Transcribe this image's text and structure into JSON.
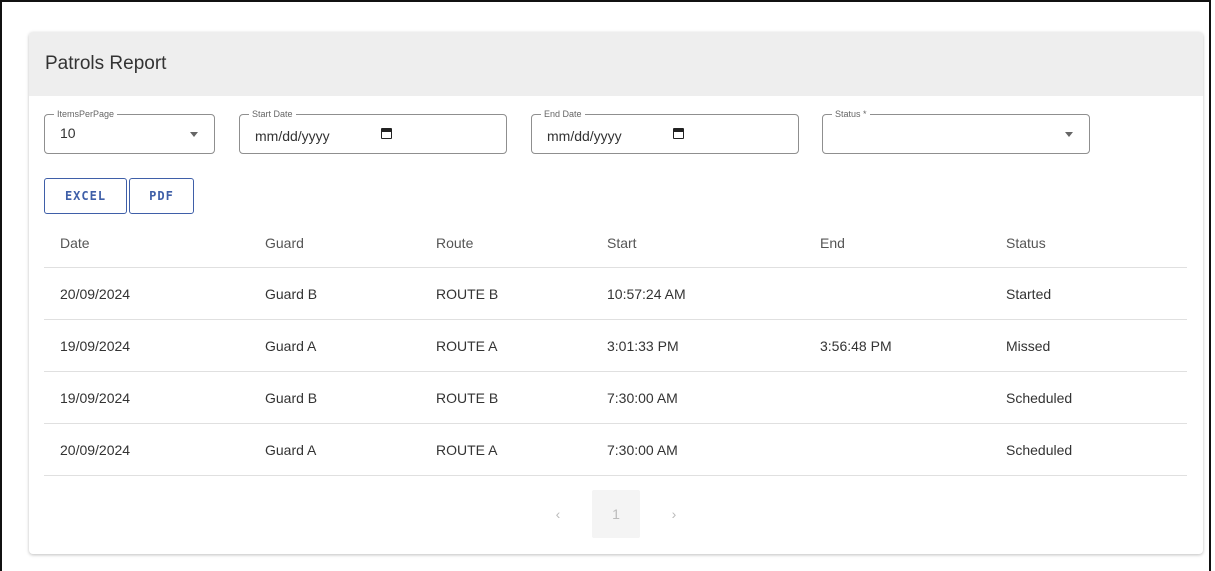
{
  "card": {
    "title": "Patrols Report"
  },
  "filters": {
    "items_per_page": {
      "label": "ItemsPerPage",
      "value": "10"
    },
    "start_date": {
      "label": "Start Date",
      "value": "mm/dd/yyyy"
    },
    "end_date": {
      "label": "End Date",
      "value": "mm/dd/yyyy"
    },
    "status": {
      "label": "Status *",
      "value": ""
    }
  },
  "actions": {
    "excel_label": "EXCEL",
    "pdf_label": "PDF"
  },
  "table": {
    "columns": [
      "Date",
      "Guard",
      "Route",
      "Start",
      "End",
      "Status"
    ],
    "rows": [
      [
        "20/09/2024",
        "Guard B",
        "ROUTE B",
        "10:57:24 AM",
        "",
        "Started"
      ],
      [
        "19/09/2024",
        "Guard A",
        "ROUTE A",
        "3:01:33 PM",
        "3:56:48 PM",
        "Missed"
      ],
      [
        "19/09/2024",
        "Guard B",
        "ROUTE B",
        "7:30:00 AM",
        "",
        "Scheduled"
      ],
      [
        "20/09/2024",
        "Guard A",
        "ROUTE A",
        "7:30:00 AM",
        "",
        "Scheduled"
      ]
    ]
  },
  "pagination": {
    "prev": "‹",
    "current": "1",
    "next": "›"
  },
  "colors": {
    "accent": "#3f5fa8",
    "header_bg": "#eeeeee"
  }
}
